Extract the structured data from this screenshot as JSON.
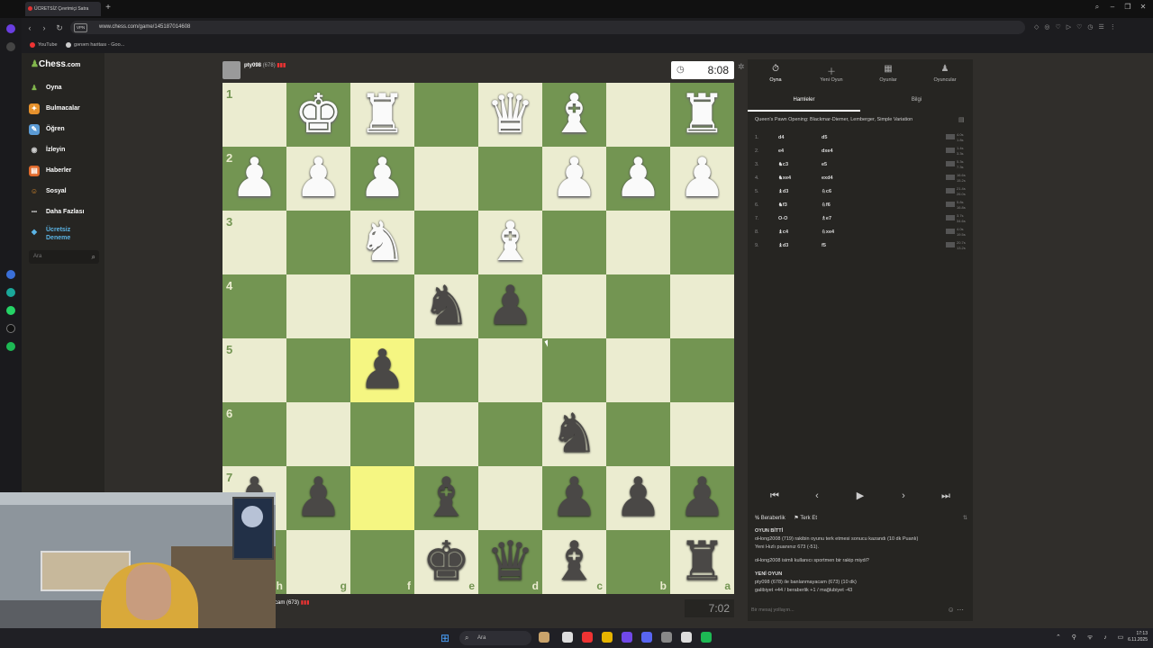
{
  "browser": {
    "tab_title": "ÜCRETSİZ Çevrimiçi Satra",
    "new_tab": "+",
    "vpn_badge": "VPN",
    "url": "www.chess.com/game/145187014608",
    "bookmarks": [
      "YouTube",
      "gənəm haritası - Goo..."
    ],
    "win_min": "–",
    "win_max": "❐",
    "win_close": "✕"
  },
  "chess_nav": {
    "logo_main": "Chess",
    "logo_suffix": ".com",
    "items": [
      {
        "label": "Oyna",
        "icon": "♟",
        "color": "#81b64c"
      },
      {
        "label": "Bulmacalar",
        "icon": "✦",
        "color": "#e6912c"
      },
      {
        "label": "Öğren",
        "icon": "🎓",
        "color": "#5b9bd5"
      },
      {
        "label": "İzleyin",
        "icon": "◉",
        "color": "#9a9a9a"
      },
      {
        "label": "Haberler",
        "icon": "▤",
        "color": "#e06a2c"
      },
      {
        "label": "Sosyal",
        "icon": "☺",
        "color": "#e6912c"
      },
      {
        "label": "Daha Fazlası",
        "icon": "•••",
        "color": "#262522"
      },
      {
        "label": "Ücretsiz",
        "icon": "◆",
        "color": "#262522"
      }
    ],
    "trial_line2": "Deneme",
    "search_placeholder": "Ara"
  },
  "game": {
    "top_player": "pty098",
    "top_rating": "(678)",
    "top_clock": "8:08",
    "bottom_player": "cam (673)",
    "bottom_clock": "7:02",
    "ranks": [
      "1",
      "2",
      "3",
      "4",
      "5",
      "6",
      "7",
      "8"
    ],
    "files": [
      "h",
      "g",
      "f",
      "e",
      "d",
      "c",
      "b",
      "a"
    ],
    "board": [
      [
        "",
        "wK",
        "wR",
        "",
        "wQ",
        "wB",
        "",
        "wR"
      ],
      [
        "wP",
        "wP",
        "wP",
        "",
        "",
        "wP",
        "wP",
        "wP"
      ],
      [
        "",
        "",
        "wN",
        "",
        "wB",
        "",
        "",
        ""
      ],
      [
        "",
        "",
        "",
        "bN",
        "bP",
        "",
        "",
        ""
      ],
      [
        "",
        "",
        "bP",
        "",
        "",
        "",
        "",
        ""
      ],
      [
        "",
        "",
        "",
        "",
        "",
        "bN",
        "",
        ""
      ],
      [
        "bP",
        "bP",
        "",
        "bB",
        "",
        "bP",
        "bP",
        "bP"
      ],
      [
        "",
        "",
        "",
        "bK",
        "bQ",
        "bB",
        "",
        "bR"
      ]
    ],
    "highlights": [
      [
        4,
        2
      ],
      [
        6,
        2
      ]
    ]
  },
  "panel": {
    "tabs": [
      {
        "label": "Oyna",
        "icon": "⏱"
      },
      {
        "label": "Yeni Oyun",
        "icon": "＋"
      },
      {
        "label": "Oyunlar",
        "icon": "▦"
      },
      {
        "label": "Oyuncular",
        "icon": "♟"
      }
    ],
    "subtabs": [
      "Hamleler",
      "Bilgi"
    ],
    "opening": "Queen's Pawn Opening: Blackmar-Diemer, Lemberger, Simple Variation",
    "moves": [
      {
        "n": "1.",
        "w": "d4",
        "b": "d5",
        "tw": "4.0s",
        "tb": "1.8s"
      },
      {
        "n": "2.",
        "w": "e4",
        "b": "dxe4",
        "tw": "1.4s",
        "tb": "3.3s"
      },
      {
        "n": "3.",
        "w": "♞c3",
        "b": "e5",
        "tw": "5.3s",
        "tb": "7.3s"
      },
      {
        "n": "4.",
        "w": "♞xe4",
        "b": "exd4",
        "tw": "16.6s",
        "tb": "15.2s"
      },
      {
        "n": "5.",
        "w": "♝d3",
        "b": "♘c6",
        "tw": "21.4s",
        "tb": "26.0s"
      },
      {
        "n": "6.",
        "w": "♞f3",
        "b": "♘f6",
        "tw": "5.8s",
        "tb": "16.8s"
      },
      {
        "n": "7.",
        "w": "O-O",
        "b": "♗e7",
        "tw": "3.7s",
        "tb": "34.6s"
      },
      {
        "n": "8.",
        "w": "♝c4",
        "b": "♘xe4",
        "tw": "4.0s",
        "tb": "19.5s"
      },
      {
        "n": "9.",
        "w": "♝d3",
        "b": "f5",
        "tw": "20.7s",
        "tb": "13.2s"
      }
    ],
    "controls": [
      "⏮",
      "‹",
      "▶",
      "›",
      "⏭"
    ],
    "draw_label": "Beraberlik",
    "resign_label": "Terk Et",
    "chat": [
      {
        "text": "OYUN BİTTİ",
        "bold": true
      },
      {
        "text": "oHong2008 (719) rakibin oyunu terk etmesi sonucu kazandı (10 dk Puanlı)",
        "bold": false
      },
      {
        "text": "Yeni Hızlı puanınız 673 (-51).",
        "bold": false
      },
      {
        "text": "oHong2008 isimli kullanıcı sportmen bir rakip miydi?",
        "bold": false
      },
      {
        "text": "YENİ OYUN",
        "bold": true
      },
      {
        "text": "pty098 (678) ile banlanmayacam (673) (10 dk)",
        "bold": false
      },
      {
        "text": "galibiyet +44 / beraberlik +1 / mağlubiyet -43",
        "bold": false
      }
    ],
    "chat_placeholder": "Bir mesaj yollayın..."
  },
  "taskbar": {
    "search": "Ara",
    "time": "17:13",
    "date": "6.11.2025"
  }
}
